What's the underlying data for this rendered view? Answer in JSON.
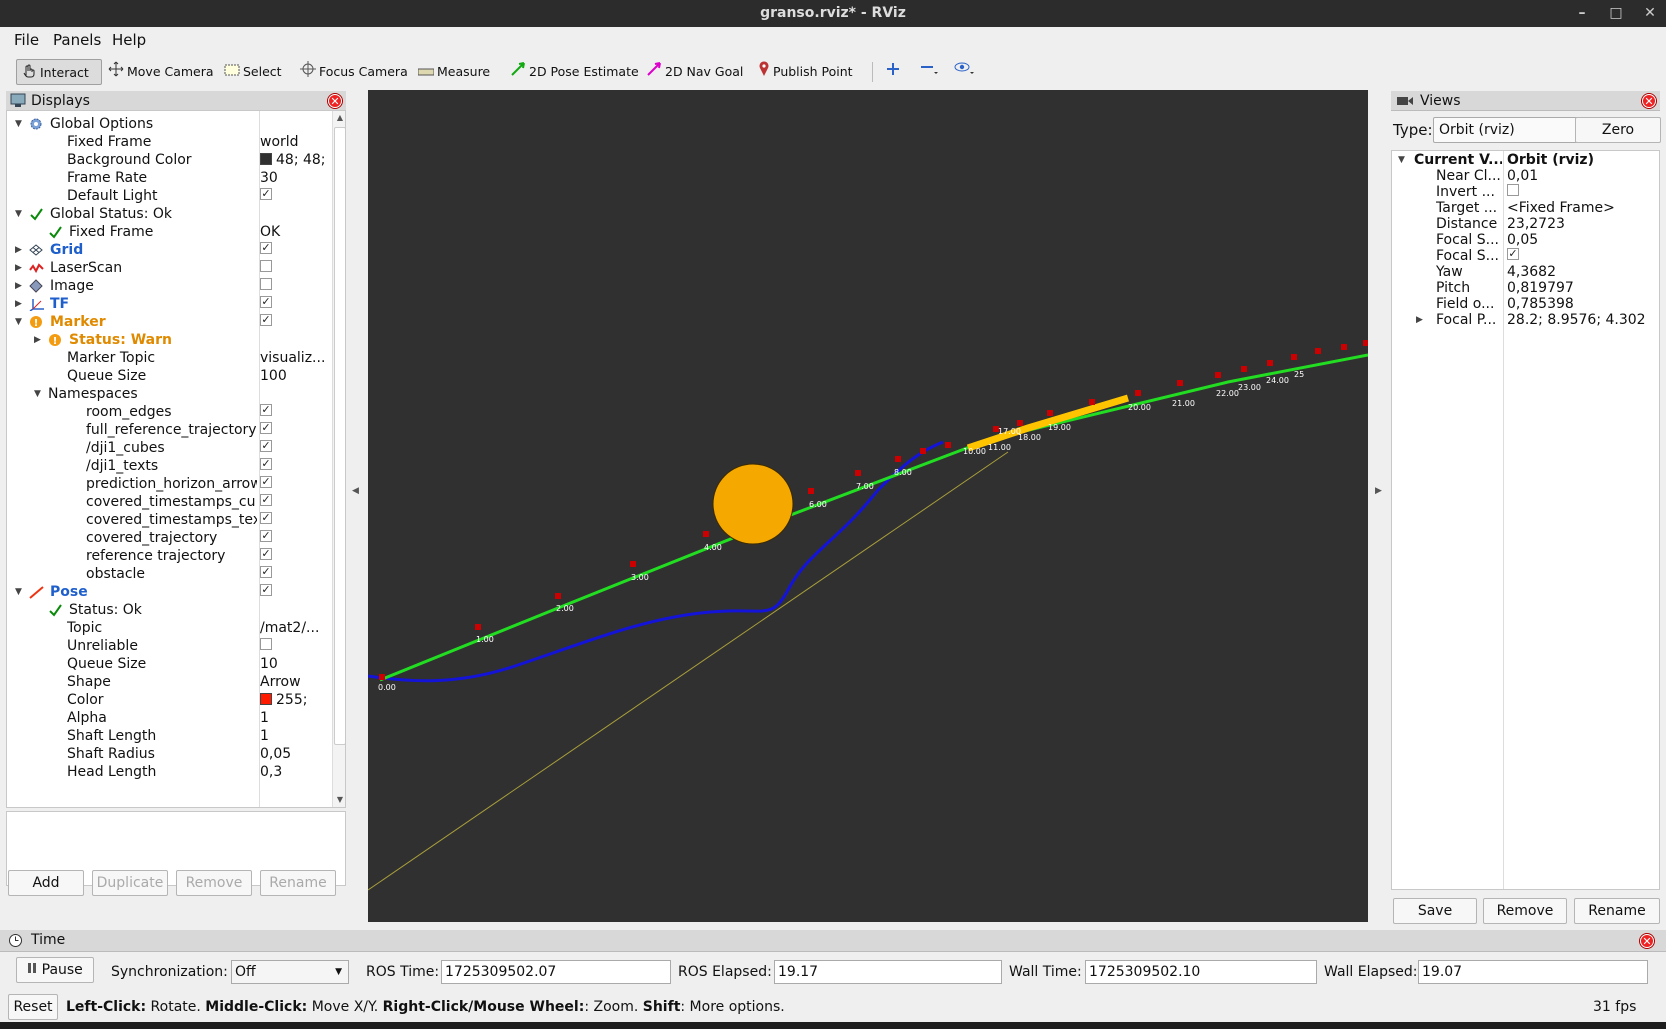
{
  "window": {
    "title": "granso.rviz* - RViz",
    "controls": [
      "–",
      "□",
      "✕"
    ]
  },
  "menu": [
    "File",
    "Panels",
    "Help"
  ],
  "toolbar": {
    "tools": [
      {
        "label": "Interact",
        "icon": "hand-cursor-icon"
      },
      {
        "label": "Move Camera",
        "icon": "move-camera-icon"
      },
      {
        "label": "Select",
        "icon": "select-box-icon"
      },
      {
        "label": "Focus Camera",
        "icon": "focus-camera-icon"
      },
      {
        "label": "Measure",
        "icon": "ruler-icon"
      },
      {
        "label": "2D Pose Estimate",
        "icon": "green-arrow-icon"
      },
      {
        "label": "2D Nav Goal",
        "icon": "pink-arrow-icon"
      },
      {
        "label": "Publish Point",
        "icon": "map-pin-icon"
      }
    ]
  },
  "displays": {
    "title": "Displays",
    "rows": [
      {
        "label": "Global Options",
        "value": ""
      },
      {
        "label": "Fixed Frame",
        "value": "world"
      },
      {
        "label": "Background Color",
        "value": "48; 48;"
      },
      {
        "label": "Frame Rate",
        "value": "30"
      },
      {
        "label": "Default Light",
        "value": ""
      },
      {
        "label": "Global Status: Ok",
        "value": ""
      },
      {
        "label": "Fixed Frame",
        "value": "OK"
      },
      {
        "label": "Grid",
        "value": ""
      },
      {
        "label": "LaserScan",
        "value": ""
      },
      {
        "label": "Image",
        "value": ""
      },
      {
        "label": "TF",
        "value": ""
      },
      {
        "label": "Marker",
        "value": ""
      },
      {
        "label": "Status: Warn",
        "value": ""
      },
      {
        "label": "Marker Topic",
        "value": "visualiz..."
      },
      {
        "label": "Queue Size",
        "value": "100"
      },
      {
        "label": "Namespaces",
        "value": ""
      },
      {
        "label": "room_edges",
        "value": ""
      },
      {
        "label": "full_reference_trajectory",
        "value": ""
      },
      {
        "label": "/dji1_cubes",
        "value": ""
      },
      {
        "label": "/dji1_texts",
        "value": ""
      },
      {
        "label": "prediction_horizon_arrows",
        "value": ""
      },
      {
        "label": "covered_timestamps_cu...",
        "value": ""
      },
      {
        "label": "covered_timestamps_texts",
        "value": ""
      },
      {
        "label": "covered_trajectory",
        "value": ""
      },
      {
        "label": "reference trajectory",
        "value": ""
      },
      {
        "label": "obstacle",
        "value": ""
      },
      {
        "label": "Pose",
        "value": ""
      },
      {
        "label": "Status: Ok",
        "value": ""
      },
      {
        "label": "Topic",
        "value": "/mat2/..."
      },
      {
        "label": "Unreliable",
        "value": ""
      },
      {
        "label": "Queue Size",
        "value": "10"
      },
      {
        "label": "Shape",
        "value": "Arrow"
      },
      {
        "label": "Color",
        "value": "255;"
      },
      {
        "label": "Alpha",
        "value": "1"
      },
      {
        "label": "Shaft Length",
        "value": "1"
      },
      {
        "label": "Shaft Radius",
        "value": "0,05"
      },
      {
        "label": "Head Length",
        "value": "0,3"
      }
    ],
    "buttons": {
      "add": "Add",
      "duplicate": "Duplicate",
      "remove": "Remove",
      "rename": "Rename"
    }
  },
  "scene": {
    "ref_labels": [
      "0.00",
      "1.00",
      "2.00",
      "3.00",
      "4.00",
      "6.00",
      "7.00",
      "8.00",
      "10.00",
      "11.00",
      "17.00",
      "18.00",
      "19.00",
      "20.00",
      "21.00",
      "22.00",
      "23.00",
      "24.00",
      "25"
    ],
    "colors": {
      "background": "#303030",
      "reference": "#22dd22",
      "covered": "#1414d8",
      "obstacle": "#f5a800",
      "highlight": "#ffc400",
      "marker": "#cc0000"
    }
  },
  "views": {
    "title": "Views",
    "type_label": "Type:",
    "type_value": "Orbit (rviz)",
    "zero": "Zero",
    "rows": [
      {
        "label": "Current V...",
        "value": "Orbit (rviz)"
      },
      {
        "label": "Near Cl...",
        "value": "0,01"
      },
      {
        "label": "Invert ...",
        "value": ""
      },
      {
        "label": "Target ...",
        "value": "<Fixed Frame>"
      },
      {
        "label": "Distance",
        "value": "23,2723"
      },
      {
        "label": "Focal S...",
        "value": "0,05"
      },
      {
        "label": "Focal S...",
        "value": ""
      },
      {
        "label": "Yaw",
        "value": "4,3682"
      },
      {
        "label": "Pitch",
        "value": "0,819797"
      },
      {
        "label": "Field o...",
        "value": "0,785398"
      },
      {
        "label": "Focal P...",
        "value": "28.2; 8.9576; 4.302"
      }
    ],
    "buttons": {
      "save": "Save",
      "remove": "Remove",
      "rename": "Rename"
    }
  },
  "time": {
    "title": "Time",
    "pause": "Pause",
    "sync_label": "Synchronization:",
    "sync_value": "Off",
    "ros_time_label": "ROS Time:",
    "ros_time": "1725309502.07",
    "ros_elapsed_label": "ROS Elapsed:",
    "ros_elapsed": "19.17",
    "wall_time_label": "Wall Time:",
    "wall_time": "1725309502.10",
    "wall_elapsed_label": "Wall Elapsed:",
    "wall_elapsed": "19.07"
  },
  "status": {
    "reset": "Reset",
    "left_click": "Left-Click:",
    "left_desc": " Rotate. ",
    "middle_click": "Middle-Click:",
    "middle_desc": " Move X/Y. ",
    "right_click": "Right-Click/Mouse Wheel:",
    "right_desc": ": Zoom. ",
    "shift": "Shift",
    "shift_desc": ": More options.",
    "fps": "31 fps"
  }
}
